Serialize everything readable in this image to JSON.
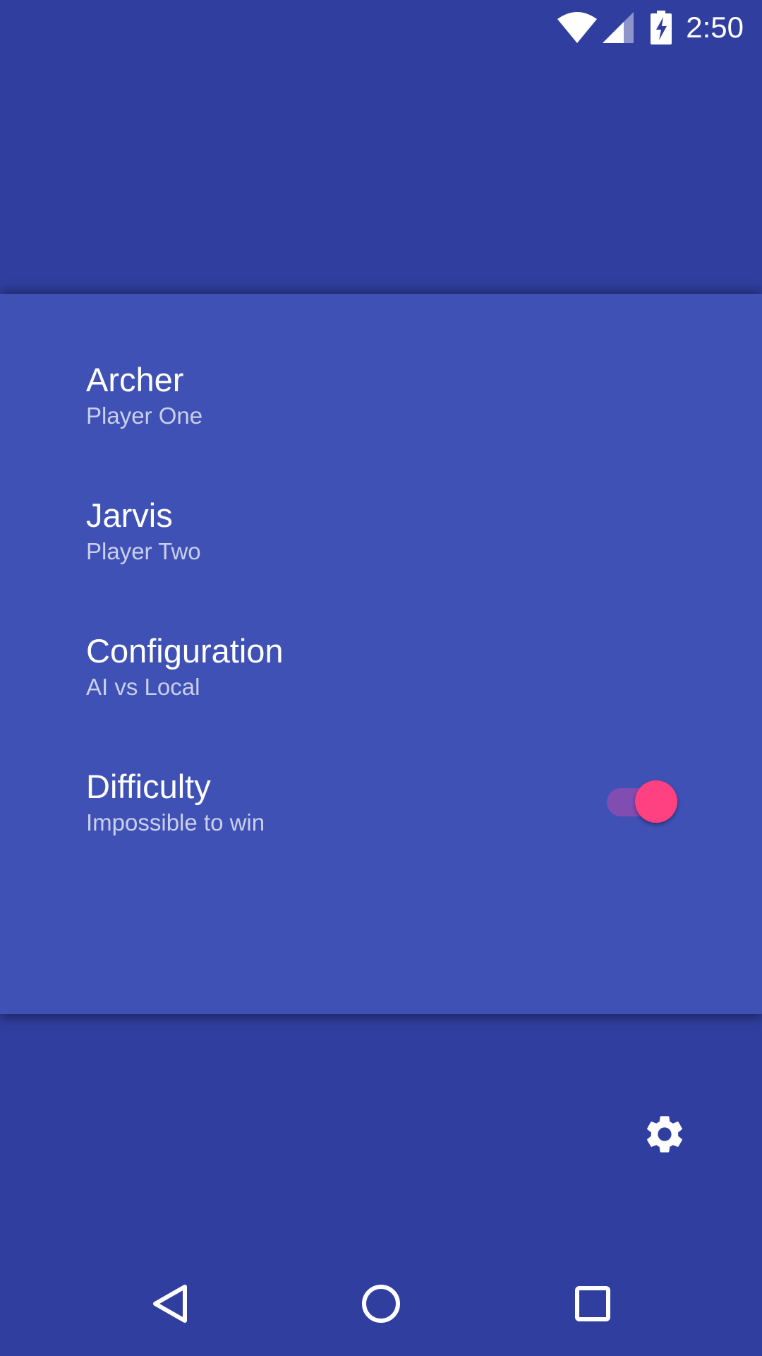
{
  "status_bar": {
    "time": "2:50",
    "icons": [
      "wifi-icon",
      "cell-signal-icon",
      "battery-charging-icon"
    ]
  },
  "settings": {
    "items": [
      {
        "title": "Archer",
        "subtitle": "Player One"
      },
      {
        "title": "Jarvis",
        "subtitle": "Player Two"
      },
      {
        "title": "Configuration",
        "subtitle": "AI vs Local"
      },
      {
        "title": "Difficulty",
        "subtitle": "Impossible to win",
        "toggle": true
      }
    ]
  },
  "fab": {
    "icon": "gear-icon"
  },
  "nav_bar": {
    "buttons": [
      "back-icon",
      "home-icon",
      "recents-icon"
    ]
  },
  "colors": {
    "background": "#303f9f",
    "panel": "#3f51b5",
    "accent": "#ff4081",
    "toggle_track": "#8a4cb0"
  }
}
